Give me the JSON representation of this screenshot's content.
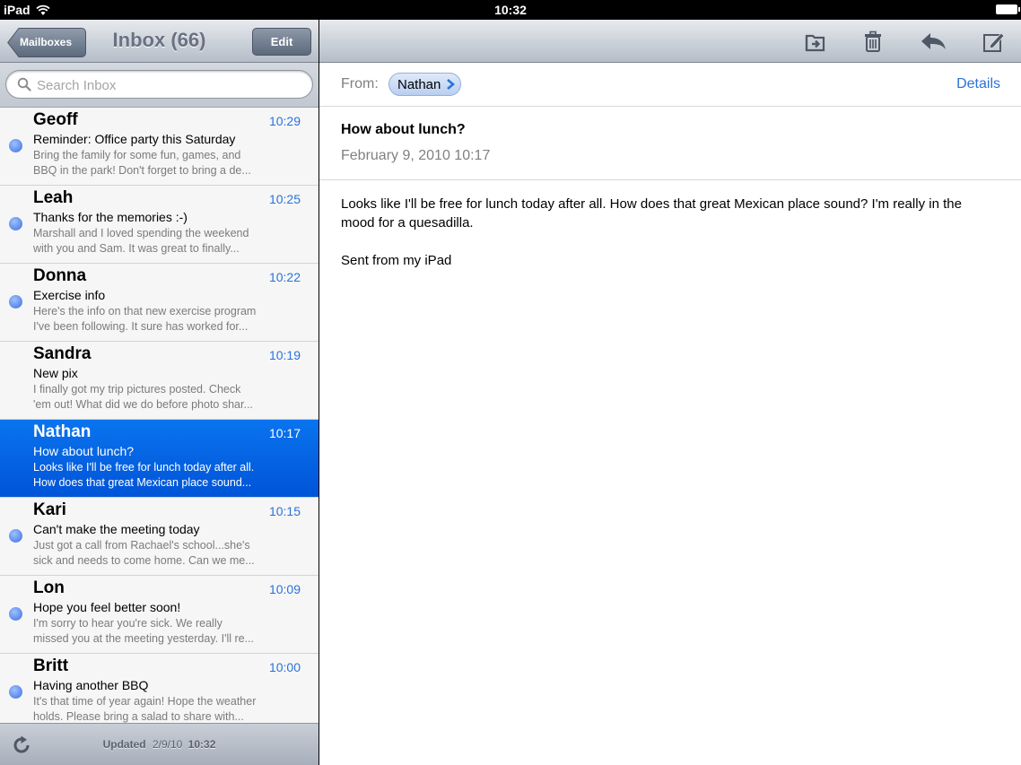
{
  "status_bar": {
    "device": "iPad",
    "time": "10:32"
  },
  "left_nav": {
    "back_label": "Mailboxes",
    "title": "Inbox (66)",
    "edit_label": "Edit"
  },
  "search": {
    "placeholder": "Search Inbox"
  },
  "messages": [
    {
      "sender": "Geoff",
      "time": "10:29",
      "subject": "Reminder: Office party this Saturday",
      "preview1": "Bring the family for some fun, games, and",
      "preview2": "BBQ in the park! Don't forget to bring a de...",
      "unread": true
    },
    {
      "sender": "Leah",
      "time": "10:25",
      "subject": "Thanks for the memories :-)",
      "preview1": "Marshall and I loved spending the weekend",
      "preview2": "with you and Sam. It was great to finally...",
      "unread": true
    },
    {
      "sender": "Donna",
      "time": "10:22",
      "subject": "Exercise info",
      "preview1": "Here's the info on that new exercise program",
      "preview2": "I've been following. It sure has worked for...",
      "unread": true
    },
    {
      "sender": "Sandra",
      "time": "10:19",
      "subject": "New pix",
      "preview1": "I finally got my trip pictures posted. Check",
      "preview2": "'em out! What did we do before photo shar...",
      "unread": false
    },
    {
      "sender": "Nathan",
      "time": "10:17",
      "subject": "How about lunch?",
      "preview1": "Looks like I'll be free for lunch today after all.",
      "preview2": "How does that great Mexican place sound...",
      "unread": false,
      "selected": true
    },
    {
      "sender": "Kari",
      "time": "10:15",
      "subject": "Can't make the meeting today",
      "preview1": "Just got a call from Rachael's school...she's",
      "preview2": "sick and needs to come home. Can we me...",
      "unread": true
    },
    {
      "sender": "Lon",
      "time": "10:09",
      "subject": "Hope you feel better soon!",
      "preview1": "I'm sorry to hear you're sick. We really",
      "preview2": "missed you at the meeting yesterday. I'll re...",
      "unread": true
    },
    {
      "sender": "Britt",
      "time": "10:00",
      "subject": "Having another BBQ",
      "preview1": "It's that time of year again! Hope the weather",
      "preview2": "holds. Please bring a salad to share with...",
      "unread": true
    }
  ],
  "left_toolbar": {
    "updated_label": "Updated",
    "updated_date": "2/9/10",
    "updated_time": "10:32"
  },
  "message_view": {
    "from_label": "From:",
    "from_name": "Nathan",
    "details_label": "Details",
    "subject": "How about lunch?",
    "date": "February 9, 2010 10:17",
    "body_line1": "Looks like I'll be free for lunch today after all. How does that great Mexican place sound? I'm really in the mood for a quesadilla.",
    "body_line2": "Sent from my iPad"
  },
  "icons": {
    "toolbar": [
      "move-folder-icon",
      "trash-icon",
      "reply-icon",
      "compose-icon"
    ],
    "accent": "#2a72d9",
    "selected_row": "#0a6ae8"
  }
}
